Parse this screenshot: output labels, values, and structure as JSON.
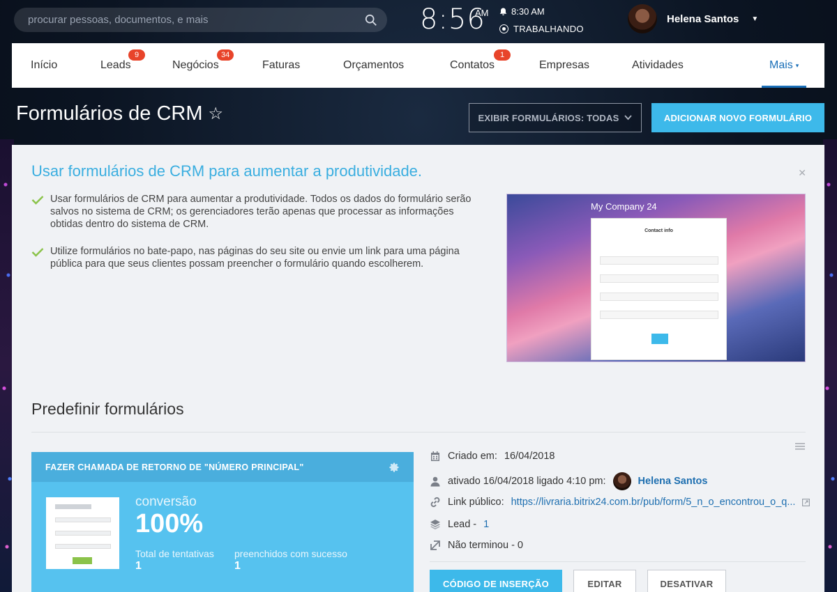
{
  "search": {
    "placeholder": "procurar pessoas, documentos, e mais"
  },
  "clock": {
    "time": "8:56",
    "ampm": "AM",
    "alarm": "8:30 AM",
    "status": "TRABALHANDO"
  },
  "user": {
    "name": "Helena Santos"
  },
  "nav": {
    "items": [
      {
        "label": "Início",
        "badge": ""
      },
      {
        "label": "Leads",
        "badge": "9"
      },
      {
        "label": "Negócios",
        "badge": "34"
      },
      {
        "label": "Faturas",
        "badge": ""
      },
      {
        "label": "Orçamentos",
        "badge": ""
      },
      {
        "label": "Contatos",
        "badge": "1"
      },
      {
        "label": "Empresas",
        "badge": ""
      },
      {
        "label": "Atividades",
        "badge": ""
      }
    ],
    "more": "Mais"
  },
  "header": {
    "title": "Formulários de CRM",
    "filter_button": "EXIBIR FORMULÁRIOS: TODAS",
    "add_button": "ADICIONAR NOVO FORMULÁRIO"
  },
  "promo": {
    "title": "Usar formulários de CRM para aumentar a produtividade.",
    "bullets": [
      "Usar formulários de CRM para aumentar a produtividade. Todos os dados do formulário serão salvos no sistema de CRM; os gerenciadores terão apenas que processar as informações obtidas dentro do sistema de CRM.",
      "Utilize formulários no bate-papo, nas páginas do seu site ou envie um link para uma página pública para que seus clientes possam preencher o formulário quando escolherem."
    ],
    "preview": {
      "brand": "My Company 24",
      "form_title": "Contact info"
    }
  },
  "presets": {
    "title": "Predefinir formulários",
    "card": {
      "title": "FAZER CHAMADA DE RETORNO DE \"NÚMERO PRINCIPAL\"",
      "conversion_label": "conversão",
      "conversion_value": "100%",
      "attempts_label": "Total de tentativas",
      "attempts_value": "1",
      "success_label": "preenchidos com sucesso",
      "success_value": "1"
    },
    "info": {
      "created_label": "Criado em:",
      "created_value": "16/04/2018",
      "activated_text": "ativado 16/04/2018 ligado 4:10 pm:",
      "activated_user": "Helena Santos",
      "public_link_label": "Link público:",
      "public_link_value": "https://livraria.bitrix24.com.br/pub/form/5_n_o_encontrou_o_q...",
      "lead_label": "Lead -",
      "lead_value": "1",
      "unfinished": "Não terminou - 0"
    },
    "actions": {
      "embed": "CÓDIGO DE INSERÇÃO",
      "edit": "EDITAR",
      "deactivate": "DESATIVAR"
    }
  },
  "colors": {
    "accent": "#3db9ea",
    "badge": "#e8442a",
    "link": "#1e6fb0",
    "check": "#8bc34a"
  }
}
